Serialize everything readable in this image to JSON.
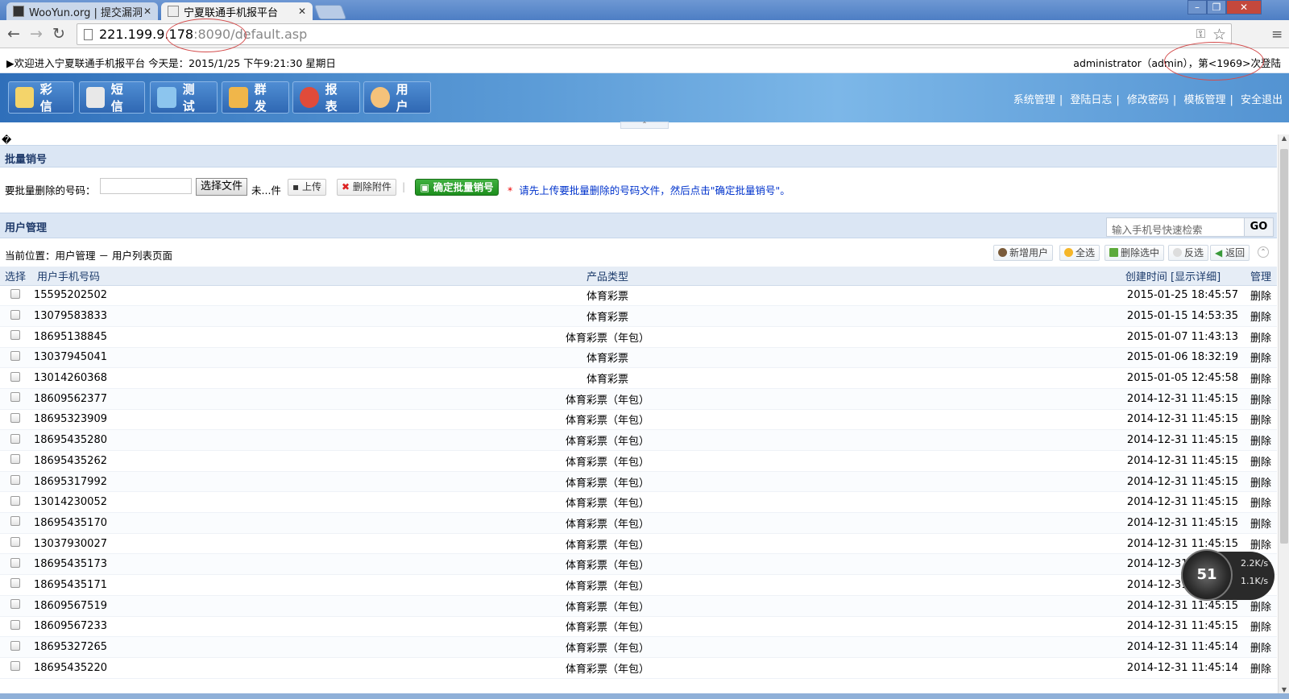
{
  "browser": {
    "tabs": [
      {
        "title": "WooYun.org | 提交漏洞",
        "active": false
      },
      {
        "title": "宁夏联通手机报平台",
        "active": true
      }
    ],
    "url_host": "221.199.9.178",
    "url_path": ":8090/default.asp",
    "window_controls": [
      "minimize",
      "restore",
      "close"
    ]
  },
  "infobar": {
    "welcome": "▶欢迎进入宁夏联通手机报平台 今天是：2015/1/25 下午9:21:30 星期日",
    "user": "administrator（admin），第<1969>次登陆"
  },
  "main_nav": [
    {
      "label": "彩信",
      "icon": "pencil-icon",
      "color": "#f4d46a"
    },
    {
      "label": "短信",
      "icon": "document-icon",
      "color": "#e8e8e8"
    },
    {
      "label": "测试",
      "icon": "user-chat-icon",
      "color": "#8cc5ee"
    },
    {
      "label": "群发",
      "icon": "user-group-icon",
      "color": "#f0b64a"
    },
    {
      "label": "报表",
      "icon": "pie-chart-icon",
      "color": "#e04b3a"
    },
    {
      "label": "用户",
      "icon": "user-icon",
      "color": "#f5c27a"
    }
  ],
  "sys_nav": [
    "系统管理",
    "登陆日志",
    "修改密码",
    "模板管理",
    "安全退出"
  ],
  "stray_char": "�",
  "batch": {
    "title": "批量销号",
    "field_label": "要批量删除的号码：",
    "choose_file": "选择文件",
    "file_status": "未...件",
    "upload": "上传",
    "delete_attachment": "删除附件",
    "confirm": "确定批量销号",
    "required_mark": "*",
    "notice": "请先上传要批量删除的号码文件，然后点击\"确定批量销号\"。"
  },
  "users": {
    "title": "用户管理",
    "search_placeholder": "输入手机号快速检索",
    "go": "GO",
    "location": "当前位置：用户管理 － 用户列表页面",
    "actions": [
      "新增用户",
      "全选",
      "删除选中",
      "反选",
      "返回"
    ],
    "columns": [
      "选择",
      "用户手机号码",
      "产品类型",
      "创建时间 [显示详细]",
      "管理"
    ],
    "rows": [
      {
        "phone": "15595202502",
        "product": "体育彩票",
        "time": "2015-01-25 18:45:57",
        "action": "删除"
      },
      {
        "phone": "13079583833",
        "product": "体育彩票",
        "time": "2015-01-15 14:53:35",
        "action": "删除"
      },
      {
        "phone": "18695138845",
        "product": "体育彩票（年包）",
        "time": "2015-01-07 11:43:13",
        "action": "删除"
      },
      {
        "phone": "13037945041",
        "product": "体育彩票",
        "time": "2015-01-06 18:32:19",
        "action": "删除"
      },
      {
        "phone": "13014260368",
        "product": "体育彩票",
        "time": "2015-01-05 12:45:58",
        "action": "删除"
      },
      {
        "phone": "18609562377",
        "product": "体育彩票（年包）",
        "time": "2014-12-31 11:45:15",
        "action": "删除"
      },
      {
        "phone": "18695323909",
        "product": "体育彩票（年包）",
        "time": "2014-12-31 11:45:15",
        "action": "删除"
      },
      {
        "phone": "18695435280",
        "product": "体育彩票（年包）",
        "time": "2014-12-31 11:45:15",
        "action": "删除"
      },
      {
        "phone": "18695435262",
        "product": "体育彩票（年包）",
        "time": "2014-12-31 11:45:15",
        "action": "删除"
      },
      {
        "phone": "18695317992",
        "product": "体育彩票（年包）",
        "time": "2014-12-31 11:45:15",
        "action": "删除"
      },
      {
        "phone": "13014230052",
        "product": "体育彩票（年包）",
        "time": "2014-12-31 11:45:15",
        "action": "删除"
      },
      {
        "phone": "18695435170",
        "product": "体育彩票（年包）",
        "time": "2014-12-31 11:45:15",
        "action": "删除"
      },
      {
        "phone": "13037930027",
        "product": "体育彩票（年包）",
        "time": "2014-12-31 11:45:15",
        "action": "删除"
      },
      {
        "phone": "18695435173",
        "product": "体育彩票（年包）",
        "time": "2014-12-31 11:45:15",
        "action": "删除"
      },
      {
        "phone": "18695435171",
        "product": "体育彩票（年包）",
        "time": "2014-12-31 11:45:15",
        "action": "删除"
      },
      {
        "phone": "18609567519",
        "product": "体育彩票（年包）",
        "time": "2014-12-31 11:45:15",
        "action": "删除"
      },
      {
        "phone": "18609567233",
        "product": "体育彩票（年包）",
        "time": "2014-12-31 11:45:15",
        "action": "删除"
      },
      {
        "phone": "18695327265",
        "product": "体育彩票（年包）",
        "time": "2014-12-31 11:45:14",
        "action": "删除"
      },
      {
        "phone": "18695435220",
        "product": "体育彩票（年包）",
        "time": "2014-12-31 11:45:14",
        "action": "删除"
      }
    ]
  },
  "speed_widget": {
    "label": "51",
    "up": "2.2K/s",
    "down": "1.1K/s"
  }
}
